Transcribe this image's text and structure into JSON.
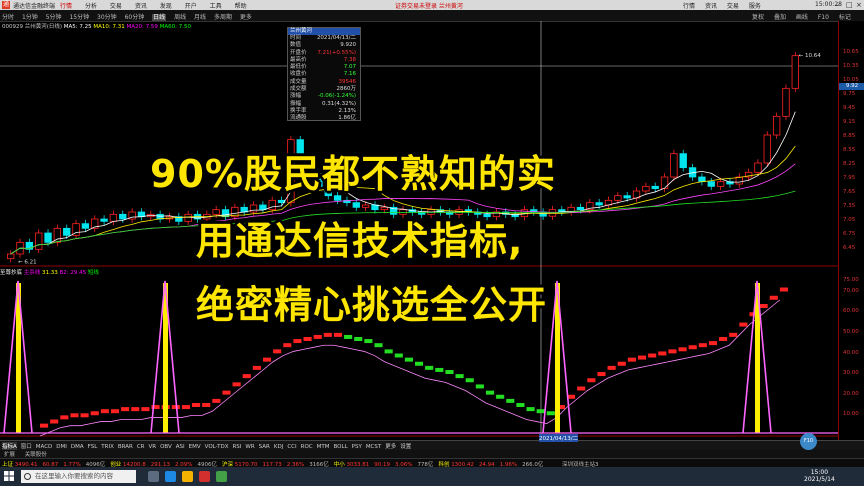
{
  "app": {
    "title": "通达信金融终端",
    "menu": [
      "行情",
      "分析",
      "交易",
      "资讯",
      "发现",
      "开户",
      "工具",
      "帮助"
    ],
    "active_menu": "行情",
    "notice": "证券交易未登录   兰州黄河",
    "right_menu": [
      "行情",
      "资讯",
      "交易",
      "服务"
    ],
    "clock": "15:00:28"
  },
  "toolbar": {
    "periods": [
      "分时",
      "1分钟",
      "5分钟",
      "15分钟",
      "30分钟",
      "60分钟",
      "日线",
      "周线",
      "月线",
      "多周期",
      "更多"
    ],
    "active_period": "日线",
    "right": [
      "复权",
      "叠加",
      "画线",
      "F10",
      "标记"
    ]
  },
  "stock": {
    "code": "000929",
    "name": "兰州黄河(日线)",
    "ma_label": "MA5: 7.25",
    "ma10": "MA10: 7.31",
    "ma20": "MA20: 7.59",
    "ma60": "MA60: 7.50"
  },
  "axis": {
    "ticks": [
      "10.65",
      "10.35",
      "10.05",
      "9.75",
      "9.45",
      "9.15",
      "8.85",
      "8.55",
      "8.25",
      "7.95",
      "7.65",
      "7.35",
      "7.05",
      "6.75",
      "6.45"
    ],
    "current_price": "9.92",
    "high_label": "10.64",
    "low_label": "6.21",
    "sub_ticks": [
      "75.00",
      "70.00",
      "60.00",
      "50.00",
      "40.00",
      "30.00",
      "20.00",
      "10.00"
    ]
  },
  "info_panel": {
    "title": "兰州黄河",
    "rows": [
      {
        "k": "时间",
        "v": "2021/04/13/二",
        "c": ""
      },
      {
        "k": "数值",
        "v": "9.920",
        "c": ""
      },
      {
        "k": "开盘价",
        "v": "7.21(+0.55%)",
        "c": "up"
      },
      {
        "k": "最高价",
        "v": "7.38",
        "c": "up"
      },
      {
        "k": "最低价",
        "v": "7.07",
        "c": "dn"
      },
      {
        "k": "收盘价",
        "v": "7.16",
        "c": "dn"
      },
      {
        "k": "成交量",
        "v": "39546",
        "c": "up"
      },
      {
        "k": "成交额",
        "v": "2860万",
        "c": ""
      },
      {
        "k": "涨幅",
        "v": "-0.06(-1.24%)",
        "c": "dn"
      },
      {
        "k": "振幅",
        "v": "0.31(4.32%)",
        "c": ""
      },
      {
        "k": "换手率",
        "v": "2.13%",
        "c": ""
      },
      {
        "k": "流通股",
        "v": "1.86亿",
        "c": ""
      }
    ]
  },
  "sub_indicator": {
    "name": "至尊抄底",
    "label1": "主杀线",
    "v1": "31.33",
    "label2": "B2: 29.45",
    "label3": "短线"
  },
  "chart_data": {
    "type": "candlestick",
    "title": "",
    "ylim": [
      6.2,
      10.7
    ],
    "closes": [
      6.35,
      6.6,
      6.45,
      6.8,
      6.6,
      6.9,
      6.75,
      7.0,
      6.9,
      7.1,
      7.05,
      7.2,
      7.1,
      7.25,
      7.15,
      7.2,
      7.1,
      7.15,
      7.05,
      7.2,
      7.1,
      7.2,
      7.3,
      7.15,
      7.35,
      7.25,
      7.4,
      7.3,
      7.5,
      7.45,
      8.8,
      8.3,
      8.0,
      7.8,
      7.6,
      7.5,
      7.45,
      7.35,
      7.4,
      7.3,
      7.35,
      7.2,
      7.3,
      7.25,
      7.2,
      7.3,
      7.25,
      7.2,
      7.3,
      7.25,
      7.2,
      7.15,
      7.25,
      7.2,
      7.15,
      7.3,
      7.25,
      7.16,
      7.3,
      7.25,
      7.35,
      7.3,
      7.45,
      7.4,
      7.5,
      7.6,
      7.55,
      7.7,
      7.8,
      7.75,
      8.0,
      8.5,
      8.2,
      8.0,
      7.9,
      7.8,
      7.9,
      7.85,
      8.0,
      8.1,
      8.3,
      8.9,
      9.3,
      9.9,
      10.6
    ],
    "oscillator_red": [
      6,
      8,
      10,
      11,
      11,
      12,
      13,
      13,
      14,
      14,
      14,
      15,
      15,
      15,
      15,
      16,
      16,
      18,
      22,
      26,
      30,
      34,
      38,
      42,
      45,
      47,
      48,
      49,
      50,
      50,
      49,
      48,
      47,
      45,
      42,
      40,
      38,
      36,
      34,
      33,
      32,
      30,
      28,
      25,
      22,
      20,
      18,
      16,
      14,
      13,
      12,
      15,
      20,
      24,
      28,
      31,
      34,
      36,
      38,
      39,
      40,
      41,
      42,
      43,
      44,
      45,
      46,
      48,
      50,
      55,
      60,
      64,
      68,
      72
    ]
  },
  "overlay": {
    "line1": "90%股民都不熟知的实",
    "line2": "用通达信技术指标,",
    "line3": "绝密精心挑选全公开"
  },
  "tabs": [
    "指标A",
    "窗口",
    "MACD",
    "DMI",
    "DMA",
    "FSL",
    "TRIX",
    "BRAR",
    "CR",
    "VR",
    "OBV",
    "ASI",
    "EMV",
    "VOL-TDX",
    "RSI",
    "WR",
    "SAR",
    "KDJ",
    "CCI",
    "ROC",
    "MTM",
    "BOLL",
    "PSY",
    "MCST",
    "更多",
    "设置"
  ],
  "active_tab": "指标A",
  "tab_date": "2021/04/13/二",
  "tab_row2": [
    "扩展",
    "关联股份"
  ],
  "status": [
    {
      "k": "上证",
      "v": "3490.41",
      "c": "up"
    },
    {
      "k": "",
      "v": "60.87",
      "c": "up"
    },
    {
      "k": "",
      "v": "1.77%",
      "c": "up"
    },
    {
      "k": "",
      "v": "4096亿",
      "c": ""
    },
    {
      "k": "创业",
      "v": "14200.8",
      "c": "up"
    },
    {
      "k": "",
      "v": "291.13",
      "c": "up"
    },
    {
      "k": "",
      "v": "2.09%",
      "c": "up"
    },
    {
      "k": "",
      "v": "4906亿",
      "c": ""
    },
    {
      "k": "沪深",
      "v": "5170.70",
      "c": "up"
    },
    {
      "k": "",
      "v": "117.73",
      "c": "up"
    },
    {
      "k": "",
      "v": "2.36%",
      "c": "up"
    },
    {
      "k": "",
      "v": "3166亿",
      "c": ""
    },
    {
      "k": "中小",
      "v": "3033.81",
      "c": "up"
    },
    {
      "k": "",
      "v": "90.19",
      "c": "up"
    },
    {
      "k": "",
      "v": "3.06%",
      "c": "up"
    },
    {
      "k": "",
      "v": "778亿",
      "c": ""
    },
    {
      "k": "科创",
      "v": "1300.42",
      "c": "up"
    },
    {
      "k": "",
      "v": "24.94",
      "c": "up"
    },
    {
      "k": "",
      "v": "1.96%",
      "c": "up"
    },
    {
      "k": "",
      "v": "266.0亿",
      "c": ""
    }
  ],
  "status_right": "深圳双线主站3",
  "taskbar": {
    "search_placeholder": "在这里输入你要搜索的内容",
    "time": "15:00",
    "date": "2021/5/14"
  },
  "colors": {
    "up": "#ff2222",
    "down": "#00e5ee",
    "pink": "#ff66ff",
    "yellow": "#ffee00",
    "green": "#22dd22",
    "axis": "#8b0000"
  }
}
